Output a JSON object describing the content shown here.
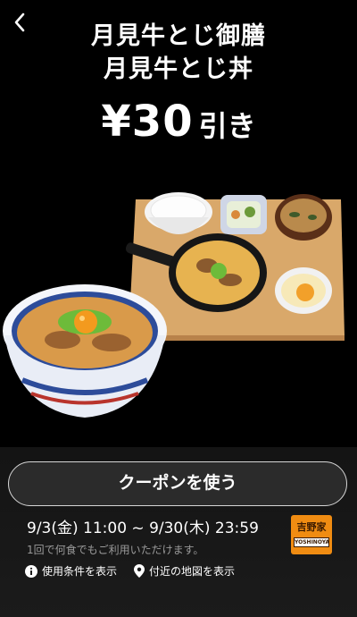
{
  "header": {
    "title_line1": "月見牛とじ御膳",
    "title_line2": "月見牛とじ丼",
    "discount_amount": "¥30",
    "discount_suffix": "引き"
  },
  "coupon": {
    "button_label": "クーポンを使う",
    "valid_period": "9/3(金) 11:00 ~ 9/30(木) 23:59",
    "usage_note": "1回で何食でもご利用いただけます。",
    "terms_link": "使用条件を表示",
    "map_link": "付近の地図を表示"
  },
  "brand": {
    "logo_text": "吉野家",
    "logo_subtext": "YOSHINOYA",
    "accent_color": "#f08c12"
  },
  "icons": {
    "back": "chevron-left-icon",
    "info": "info-icon",
    "map": "map-pin-icon"
  }
}
